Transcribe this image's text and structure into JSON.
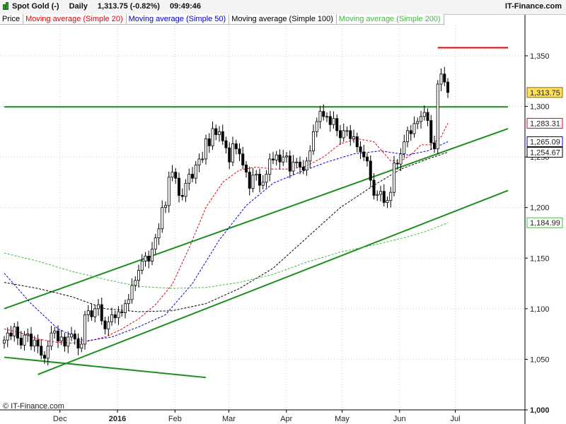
{
  "header": {
    "instrument": "Spot Gold (-)",
    "period": "Daily",
    "quote": "1,313.75 (-0.82%)",
    "time": "09:49:46",
    "brand": "IT-Finance.com"
  },
  "legend": [
    {
      "label": "Price",
      "color": "#000000"
    },
    {
      "label": "Moving average (Simple 20)",
      "color": "#e8000b"
    },
    {
      "label": "Moving average (Simple 50)",
      "color": "#0000d0"
    },
    {
      "label": "Moving average (Simple 100)",
      "color": "#000000"
    },
    {
      "label": "Moving average (Simple 200)",
      "color": "#44bb44"
    }
  ],
  "footer": {
    "copyright": "© IT-Finance.com"
  },
  "chart_data": {
    "type": "candlestick",
    "instrument": "Spot Gold",
    "interval": "Daily",
    "y_axis": {
      "side": "right",
      "ylim": [
        1000,
        1380
      ],
      "ticks": [
        1000,
        1050,
        1100,
        1150,
        1200,
        1250,
        1300,
        1350
      ],
      "tick_labels": [
        "1,000",
        "1,050",
        "1,100",
        "1,150",
        "1,200",
        "1,250",
        "1,300",
        "1,350"
      ]
    },
    "x_axis": {
      "labels": [
        "Dec",
        "2016",
        "Feb",
        "Mar",
        "Apr",
        "May",
        "Jun",
        "Jul"
      ],
      "dates": [
        "2015-12-01",
        "2016-01-01",
        "2016-02-01",
        "2016-03-01",
        "2016-04-01",
        "2016-05-01",
        "2016-06-01",
        "2016-07-01"
      ],
      "bold_label": "2016"
    },
    "grid": true,
    "price_series": {
      "name": "Spot Gold",
      "closes": [
        1069,
        1076,
        1073,
        1082,
        1071,
        1064,
        1074,
        1075,
        1063,
        1069,
        1063,
        1054,
        1051,
        1063,
        1076,
        1078,
        1068,
        1072,
        1063,
        1072,
        1075,
        1070,
        1061,
        1065,
        1094,
        1098,
        1092,
        1100,
        1104,
        1088,
        1080,
        1087,
        1094,
        1091,
        1097,
        1096,
        1105,
        1109,
        1123,
        1128,
        1138,
        1147,
        1152,
        1147,
        1159,
        1170,
        1179,
        1200,
        1202,
        1230,
        1235,
        1229,
        1212,
        1211,
        1224,
        1233,
        1229,
        1242,
        1248,
        1248,
        1268,
        1261,
        1278,
        1272,
        1275,
        1266,
        1259,
        1245,
        1263,
        1258,
        1253,
        1242,
        1235,
        1219,
        1232,
        1233,
        1222,
        1225,
        1233,
        1248,
        1247,
        1252,
        1245,
        1250,
        1251,
        1236,
        1245,
        1245,
        1240,
        1237,
        1246,
        1256,
        1275,
        1285,
        1295,
        1290,
        1290,
        1282,
        1288,
        1276,
        1269,
        1276,
        1276,
        1268,
        1270,
        1260,
        1255,
        1250,
        1246,
        1227,
        1212,
        1213,
        1216,
        1205,
        1207,
        1215,
        1244,
        1243,
        1253,
        1265,
        1276,
        1273,
        1283,
        1285,
        1290,
        1294,
        1286,
        1264,
        1258,
        1322,
        1332,
        1324,
        1313.75
      ],
      "latest": 1313.75,
      "latest_label": "1,313.75"
    },
    "moving_averages": [
      {
        "name": "Moving average (Simple 20)",
        "period": 20,
        "color": "#e8000b",
        "values": [
          [
            0,
            1080
          ],
          [
            5,
            1076
          ],
          [
            10,
            1070
          ],
          [
            15,
            1067
          ],
          [
            20,
            1066
          ],
          [
            25,
            1068
          ],
          [
            30,
            1072
          ],
          [
            35,
            1080
          ],
          [
            40,
            1090
          ],
          [
            45,
            1104
          ],
          [
            50,
            1124
          ],
          [
            55,
            1160
          ],
          [
            60,
            1200
          ],
          [
            65,
            1225
          ],
          [
            70,
            1237
          ],
          [
            75,
            1240
          ],
          [
            80,
            1238
          ],
          [
            85,
            1238
          ],
          [
            90,
            1241
          ],
          [
            95,
            1250
          ],
          [
            100,
            1263
          ],
          [
            105,
            1268
          ],
          [
            110,
            1265
          ],
          [
            115,
            1246
          ],
          [
            118,
            1246
          ],
          [
            121,
            1252
          ],
          [
            124,
            1262
          ],
          [
            127,
            1262
          ],
          [
            130,
            1270
          ],
          [
            132,
            1283.31
          ]
        ],
        "latest_label": "1,283.31"
      },
      {
        "name": "Moving average (Simple 50)",
        "period": 50,
        "color": "#0000d0",
        "values": [
          [
            0,
            1135
          ],
          [
            8,
            1105
          ],
          [
            16,
            1080
          ],
          [
            24,
            1068
          ],
          [
            32,
            1072
          ],
          [
            40,
            1082
          ],
          [
            48,
            1094
          ],
          [
            56,
            1125
          ],
          [
            64,
            1168
          ],
          [
            72,
            1202
          ],
          [
            80,
            1224
          ],
          [
            88,
            1235
          ],
          [
            96,
            1245
          ],
          [
            104,
            1253
          ],
          [
            112,
            1256
          ],
          [
            120,
            1252
          ],
          [
            126,
            1256
          ],
          [
            132,
            1265.09
          ]
        ],
        "latest_label": "1,265.09"
      },
      {
        "name": "Moving average (Simple 100)",
        "period": 100,
        "color": "#000000",
        "values": [
          [
            0,
            1126
          ],
          [
            10,
            1120
          ],
          [
            20,
            1112
          ],
          [
            30,
            1100
          ],
          [
            40,
            1097
          ],
          [
            50,
            1098
          ],
          [
            60,
            1105
          ],
          [
            70,
            1120
          ],
          [
            80,
            1140
          ],
          [
            90,
            1170
          ],
          [
            100,
            1200
          ],
          [
            110,
            1222
          ],
          [
            118,
            1238
          ],
          [
            126,
            1248
          ],
          [
            132,
            1254.67
          ]
        ],
        "latest_label": "1,254.67"
      },
      {
        "name": "Moving average (Simple 200)",
        "period": 200,
        "color": "#44bb44",
        "values": [
          [
            0,
            1155
          ],
          [
            10,
            1147
          ],
          [
            20,
            1137
          ],
          [
            30,
            1129
          ],
          [
            40,
            1122
          ],
          [
            50,
            1120
          ],
          [
            60,
            1121
          ],
          [
            70,
            1126
          ],
          [
            80,
            1134
          ],
          [
            90,
            1146
          ],
          [
            100,
            1156
          ],
          [
            110,
            1163
          ],
          [
            120,
            1171
          ],
          [
            126,
            1177
          ],
          [
            132,
            1184.99
          ]
        ],
        "latest_label": "1,184.99"
      }
    ],
    "trendlines": [
      {
        "color": "#1b8f1b",
        "from": [
          0,
          1299.5
        ],
        "to": [
          160,
          1299.5
        ]
      },
      {
        "color": "#1b8f1b",
        "from": [
          0,
          1100
        ],
        "to": [
          160,
          1290
        ]
      },
      {
        "color": "#1b8f1b",
        "from": [
          10,
          1035
        ],
        "to": [
          160,
          1230
        ]
      },
      {
        "color": "#1b8f1b",
        "from": [
          0,
          1052
        ],
        "to": [
          60,
          1032
        ]
      },
      {
        "color": "#e8000b",
        "from": [
          129,
          1358
        ],
        "to": [
          160,
          1358
        ]
      }
    ]
  }
}
